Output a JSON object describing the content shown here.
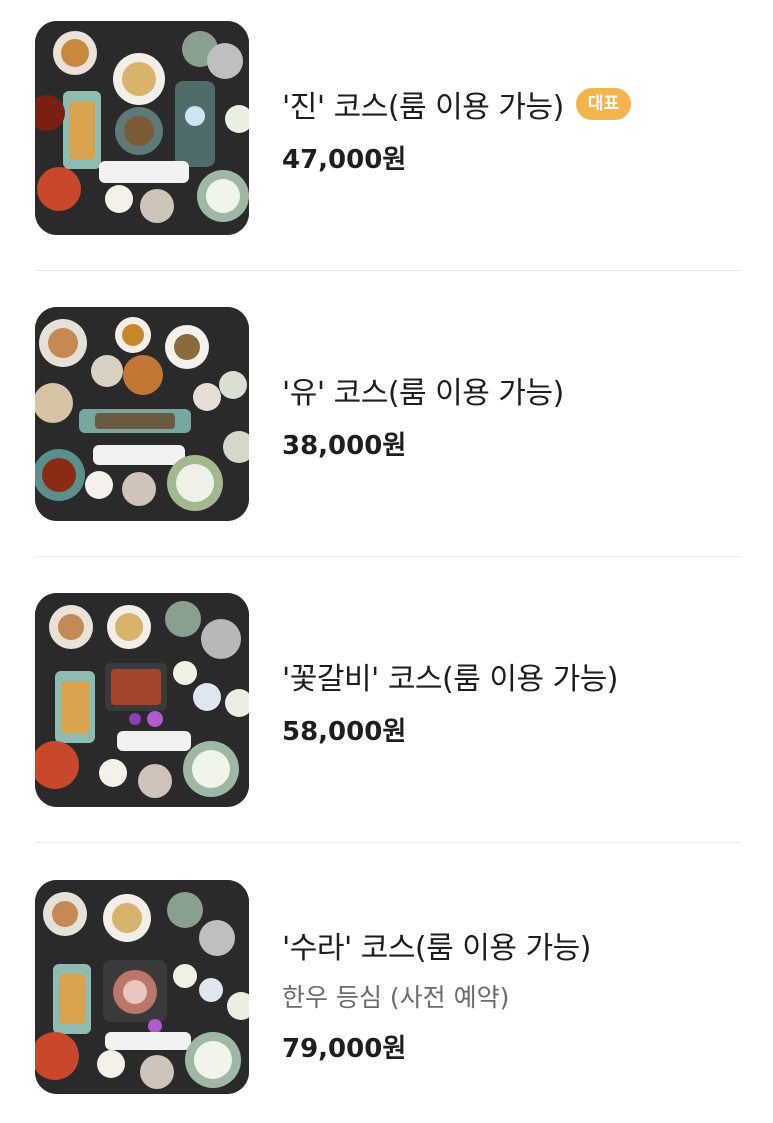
{
  "menu": {
    "items": [
      {
        "name": "'진' 코스(룸 이용 가능)",
        "badge": "대표",
        "price": "47,000원",
        "image": "course-meal-photo"
      },
      {
        "name": "'유' 코스(룸 이용 가능)",
        "price": "38,000원",
        "image": "course-meal-photo"
      },
      {
        "name": "'꽃갈비' 코스(룸 이용 가능)",
        "price": "58,000원",
        "image": "course-meal-photo"
      },
      {
        "name": "'수라' 코스(룸 이용 가능)",
        "description": "한우 등심 (사전 예약)",
        "price": "79,000원",
        "image": "course-meal-photo"
      }
    ]
  },
  "colors": {
    "badge": "#f3b34f",
    "divider": "#e9e9e9",
    "text": "#1e1e1e",
    "muted": "#6b6b6b"
  }
}
